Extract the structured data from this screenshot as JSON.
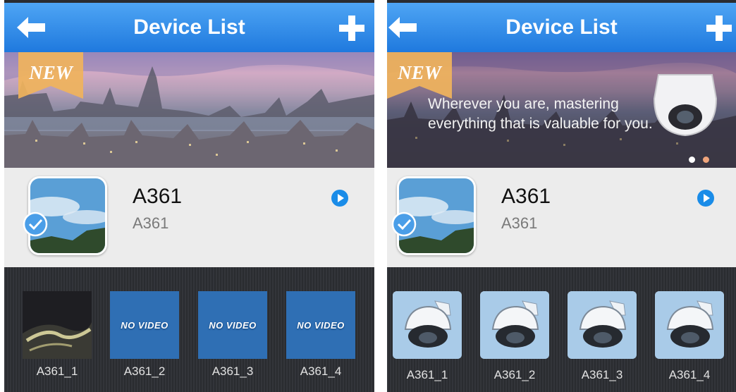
{
  "screens": [
    {
      "nav": {
        "title": "Device List"
      },
      "banner": {
        "badge": "NEW",
        "caption": ""
      },
      "device": {
        "name": "A361",
        "sub": "A361"
      },
      "channels": [
        {
          "label": "A361_1",
          "thumb": "night-city"
        },
        {
          "label": "A361_2",
          "thumb": "no-video",
          "text": "NO VIDEO"
        },
        {
          "label": "A361_3",
          "thumb": "no-video",
          "text": "NO VIDEO"
        },
        {
          "label": "A361_4",
          "thumb": "no-video",
          "text": "NO VIDEO"
        }
      ]
    },
    {
      "nav": {
        "title": "Device List"
      },
      "banner": {
        "badge": "NEW",
        "caption": "Wherever you are, mastering everything that is valuable for you."
      },
      "device": {
        "name": "A361",
        "sub": "A361"
      },
      "channels": [
        {
          "label": "A361_1",
          "thumb": "camera-icon"
        },
        {
          "label": "A361_2",
          "thumb": "camera-icon"
        },
        {
          "label": "A361_3",
          "thumb": "camera-icon"
        },
        {
          "label": "A361_4",
          "thumb": "camera-icon"
        }
      ]
    }
  ],
  "colors": {
    "nav_top": "#4ea5f4",
    "nav_bottom": "#1f79de",
    "accent": "#1a8ce8",
    "badge": "#f0b35c"
  },
  "icons": [
    "back-arrow-icon",
    "plus-icon",
    "check-icon",
    "play-icon",
    "security-camera-icon"
  ]
}
